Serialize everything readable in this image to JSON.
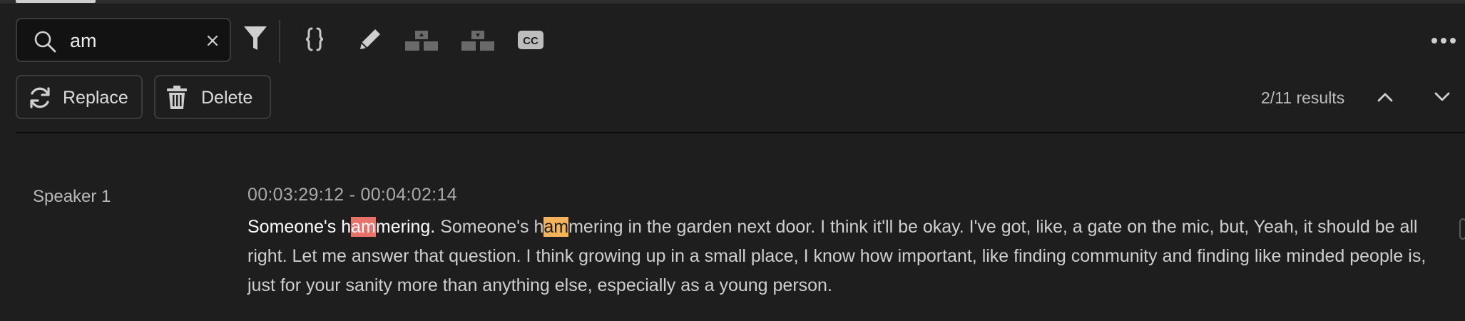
{
  "search": {
    "value": "am"
  },
  "toolbar": {
    "icons": [
      "filter-icon",
      "braces-icon",
      "pencil-icon",
      "merge-icon",
      "split-icon",
      "cc-icon",
      "more-icon"
    ],
    "cc_text": "CC"
  },
  "actions": {
    "replace_label": "Replace",
    "delete_label": "Delete"
  },
  "results": {
    "count_text": "2/11 results"
  },
  "transcript": {
    "speaker": "Speaker 1",
    "timecode": "00:03:29:12 - 00:04:02:14",
    "seg1_a": "Someone's h",
    "seg1_hl": "am",
    "seg1_b": "mering.",
    "seg2_a": " Someone's h",
    "seg2_hl": "am",
    "seg2_b": "mering in the garden next door. I think it'll be okay. I've got, like, a gate on the mic, but, Yeah, it should be all right. Let me answer that question. I think growing up in a small place, I know how important, like finding community and finding like minded people is, just for your sanity more than anything else, especially as a young person."
  },
  "colors": {
    "background": "#1e1e1e",
    "highlight_current": "#e8726a",
    "highlight_match": "#f4b25b"
  }
}
